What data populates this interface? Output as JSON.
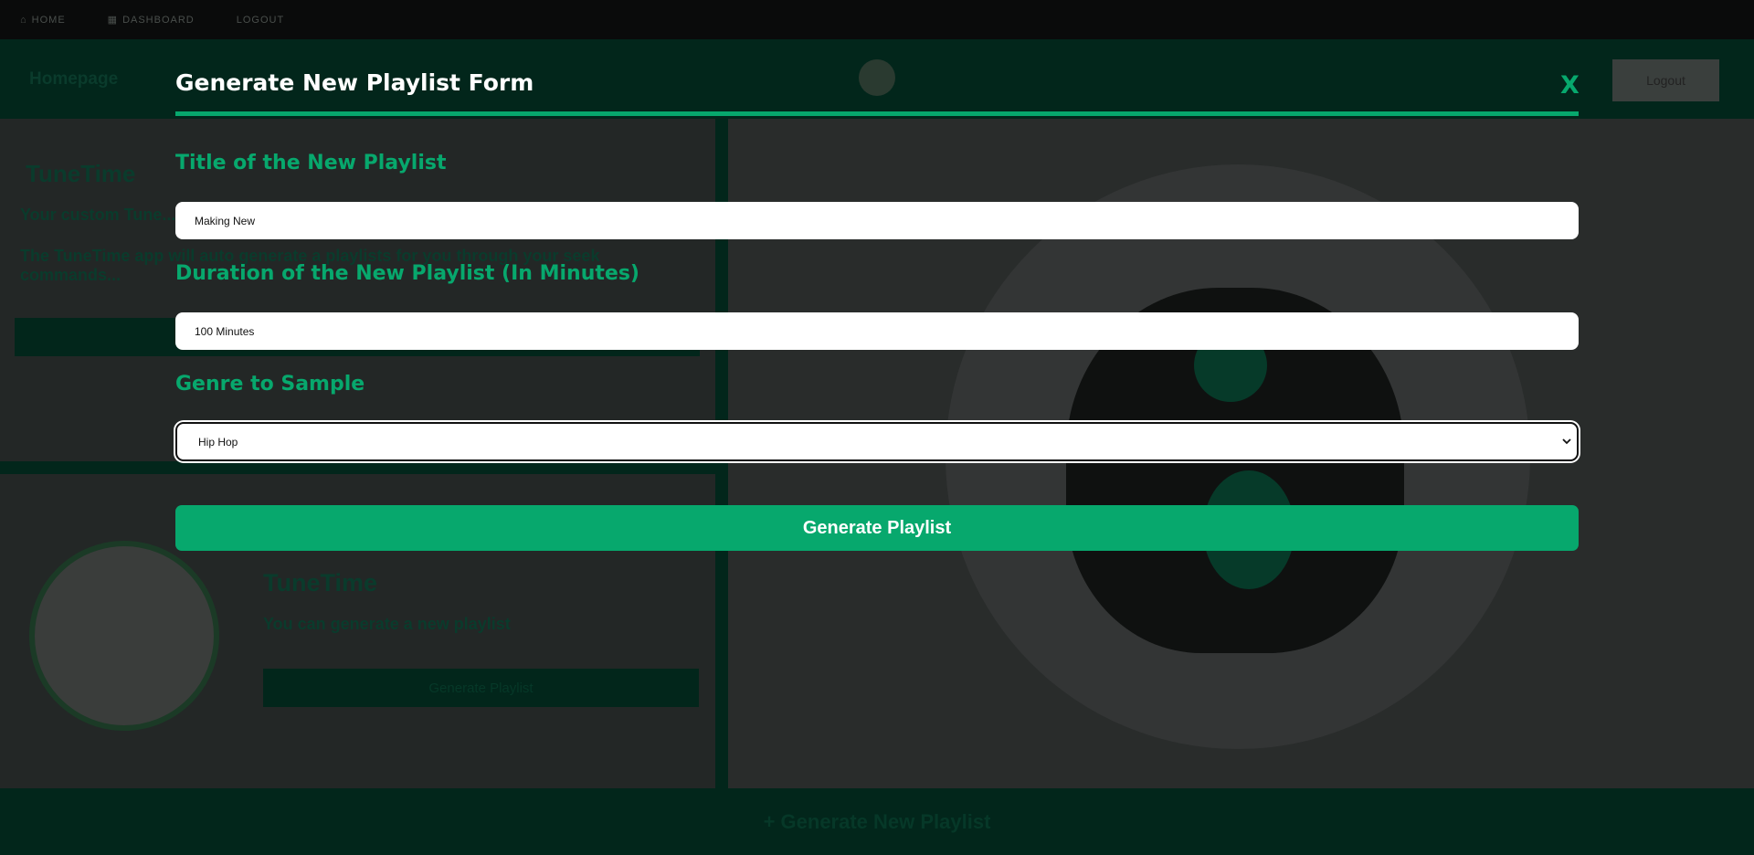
{
  "background": {
    "nav": {
      "home": "HOME",
      "dashboard": "DASHBOARD",
      "logout": "LOGOUT"
    },
    "header": {
      "homepage": "Homepage",
      "logout_button": "Logout"
    },
    "left_panel": {
      "app_title": "TuneTime",
      "tagline": "Your custom Tune...",
      "description": "The TuneTime app will auto generate a playlists for you through your seek commands..."
    },
    "card": {
      "title": "TuneTime",
      "subtitle": "You can generate a new playlist",
      "button": "Generate Playlist"
    },
    "footer_button": "Generate New Playlist"
  },
  "modal": {
    "title": "Generate New Playlist Form",
    "close_label": "X",
    "fields": {
      "title_label": "Title of the New Playlist",
      "title_value": "Making New",
      "duration_label": "Duration of the New Playlist (In Minutes)",
      "duration_value": "100 Minutes",
      "genre_label": "Genre to Sample",
      "genre_value": "Hip Hop"
    },
    "submit_label": "Generate Playlist"
  },
  "colors": {
    "accent": "#07a86d",
    "dark_green": "#02261b",
    "overlay_bg": "#232726"
  }
}
